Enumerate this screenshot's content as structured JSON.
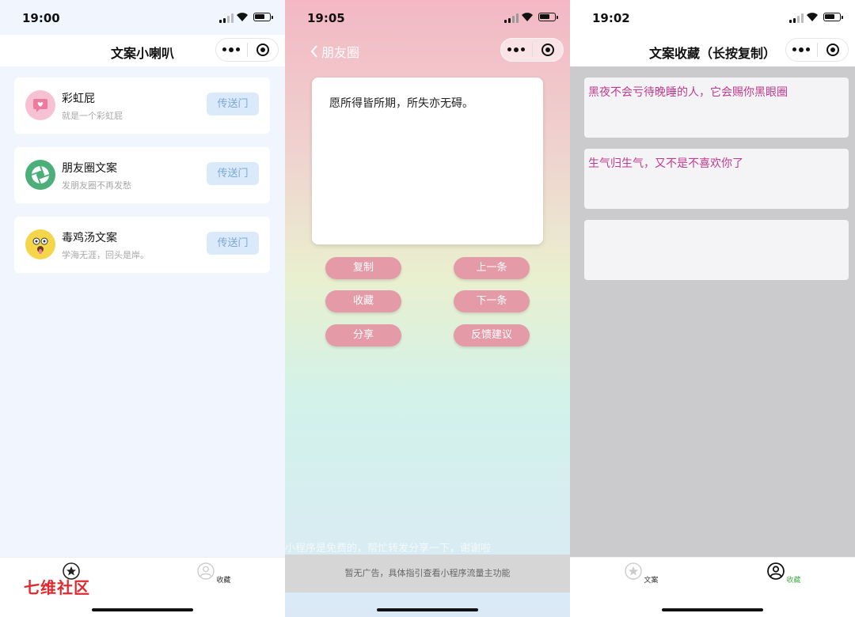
{
  "panel1": {
    "time": "19:00",
    "title": "文案小喇叭",
    "items": [
      {
        "name": "彩虹屁",
        "desc": "就是一个彩虹屁",
        "button": "传送门",
        "icon": "heart-chat-icon",
        "color": "#f4b7c9"
      },
      {
        "name": "朋友圈文案",
        "desc": "发朋友圈不再发愁",
        "button": "传送门",
        "icon": "aperture-icon",
        "color": "#4caf7a"
      },
      {
        "name": "毒鸡汤文案",
        "desc": "学海无涯，回头是岸。",
        "button": "传送门",
        "icon": "funny-face-icon",
        "color": "#f5d54a"
      }
    ],
    "tabs": {
      "tab1_label": "",
      "tab2_label": "收藏"
    },
    "watermark": "七维社区"
  },
  "panel2": {
    "time": "19:05",
    "back_label": "朋友圈",
    "quote": "愿所得皆所期，所失亦无碍。",
    "buttons": {
      "copy": "复制",
      "prev": "上一条",
      "collect": "收藏",
      "next": "下一条",
      "share": "分享",
      "feedback": "反馈建议"
    },
    "share_hint": "小程序是免费的，帮忙转发分享一下，谢谢啦",
    "ad_text": "暂无广告，具体指引查看小程序流量主功能"
  },
  "panel3": {
    "time": "19:02",
    "title": "文案收藏（长按复制）",
    "favorites": [
      "黑夜不会亏待晚睡的人，它会赐你黑眼圈",
      "生气归生气，又不是不喜欢你了",
      ""
    ],
    "tabs": {
      "tab1_label": "文案",
      "tab2_label": "收藏"
    },
    "accent": "#4caf50"
  }
}
